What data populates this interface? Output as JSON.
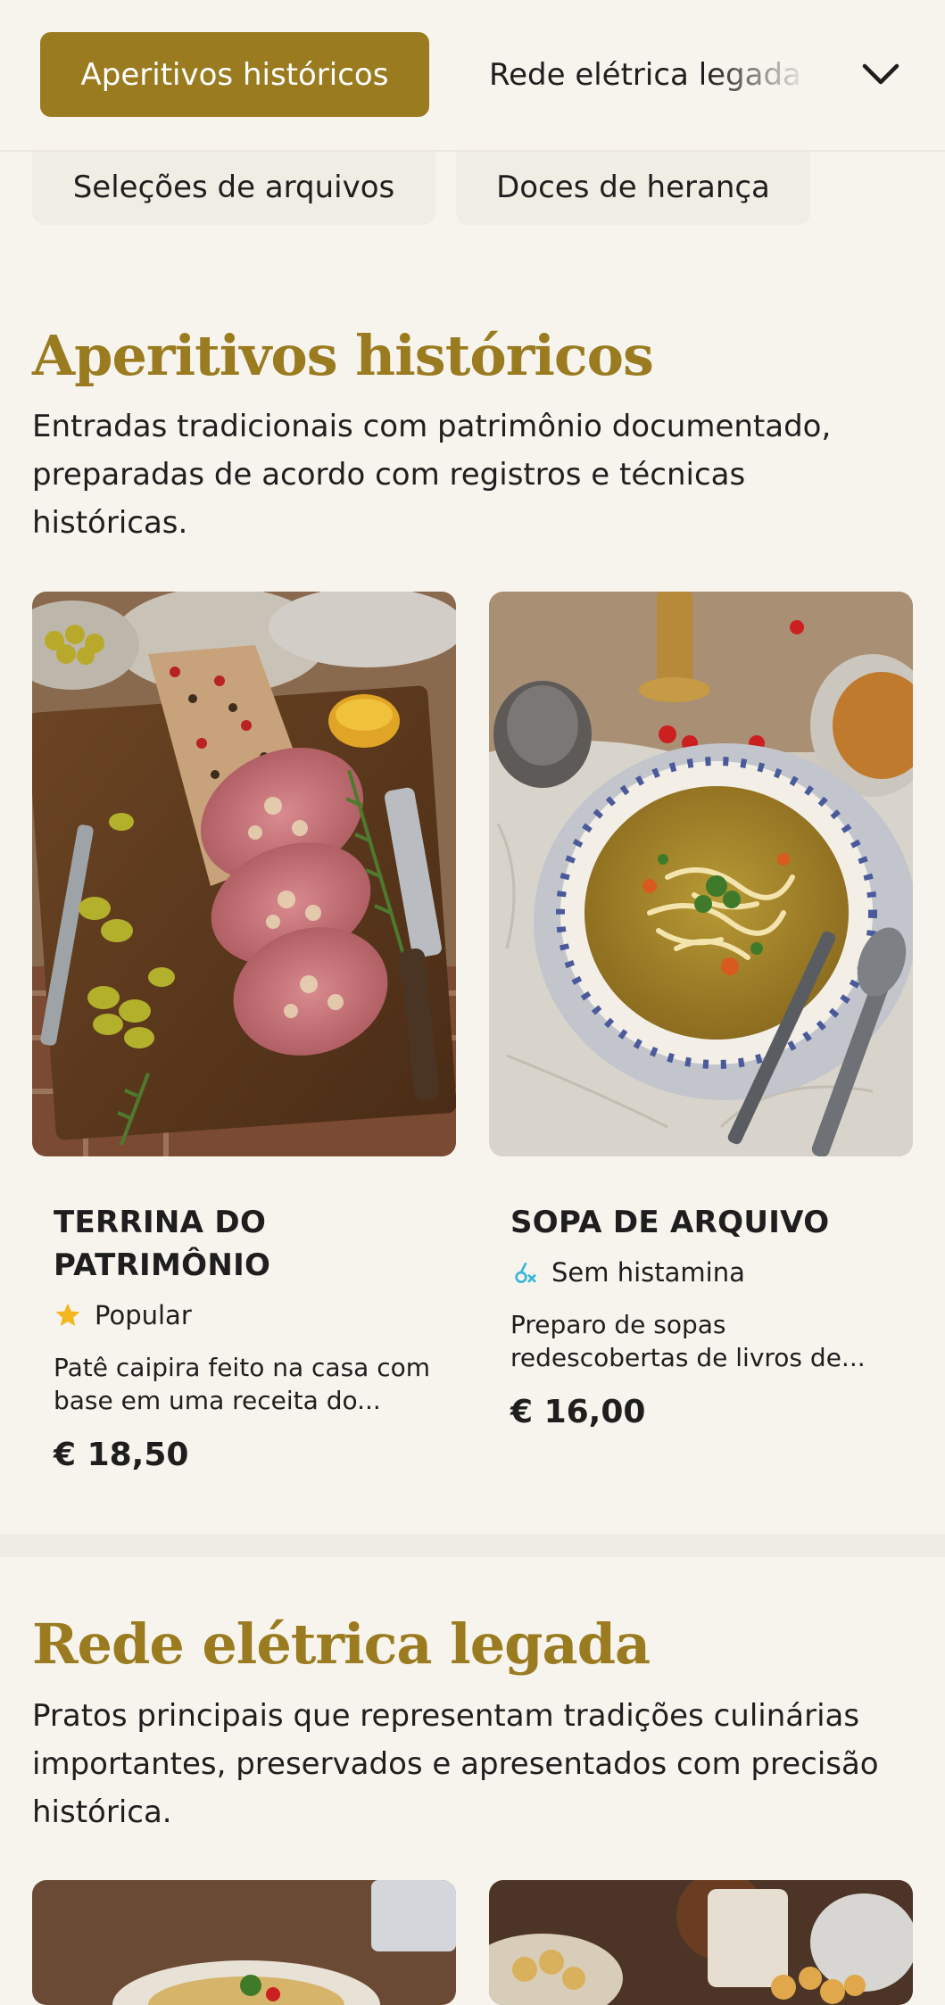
{
  "category_nav": {
    "active_label": "Aperitivos históricos",
    "next_label": "Rede elétrica legada",
    "toggle_icon": "chevron-down-icon",
    "extra_categories": [
      "Seleções de arquivos",
      "Doces de herança"
    ],
    "accent_color": "#9a7b1f"
  },
  "sections": [
    {
      "title": "Aperitivos históricos",
      "description": "Entradas tradicionais com patrimônio documentado, preparadas de acordo com registros e técnicas históricas.",
      "items": [
        {
          "name": "TERRINA DO PATRIMÔNIO",
          "badge": {
            "icon": "star-icon",
            "label": "Popular",
            "color": "#f2b71e"
          },
          "description": "Patê caipira feito na casa com base em uma receita do...",
          "price": "€ 18,50"
        },
        {
          "name": "SOPA DE ARQUIVO",
          "badge": {
            "icon": "histamine-free-icon",
            "label": "Sem histamina",
            "color": "#38b6d8"
          },
          "description": "Preparo de sopas redescobertas de livros de...",
          "price": "€ 16,00"
        }
      ]
    },
    {
      "title": "Rede elétrica legada",
      "description": "Pratos principais que representam tradições culinárias importantes, preservados e apresentados com precisão histórica."
    }
  ]
}
